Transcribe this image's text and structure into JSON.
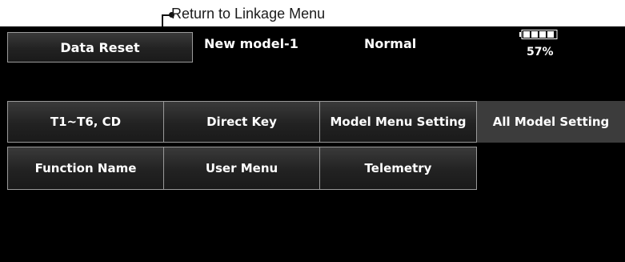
{
  "callout": {
    "text": "Return to Linkage Menu"
  },
  "header": {
    "data_reset_label": "Data Reset",
    "model_name": "New model-1",
    "condition": "Normal",
    "battery_percent": "57%",
    "battery_level": 0.57
  },
  "menu": {
    "row1": [
      "T1~T6, CD",
      "Direct Key",
      "Model Menu Setting",
      "All Model Setting"
    ],
    "row2": [
      "Function Name",
      "User Menu",
      "Telemetry"
    ]
  },
  "colors": {
    "screen_bg": "#000000",
    "button_border": "#9a9a9a",
    "selected_bg": "#3c3c3c"
  },
  "icons": {
    "battery": "battery-icon",
    "callout_bullet": "bullet-dot-icon"
  }
}
